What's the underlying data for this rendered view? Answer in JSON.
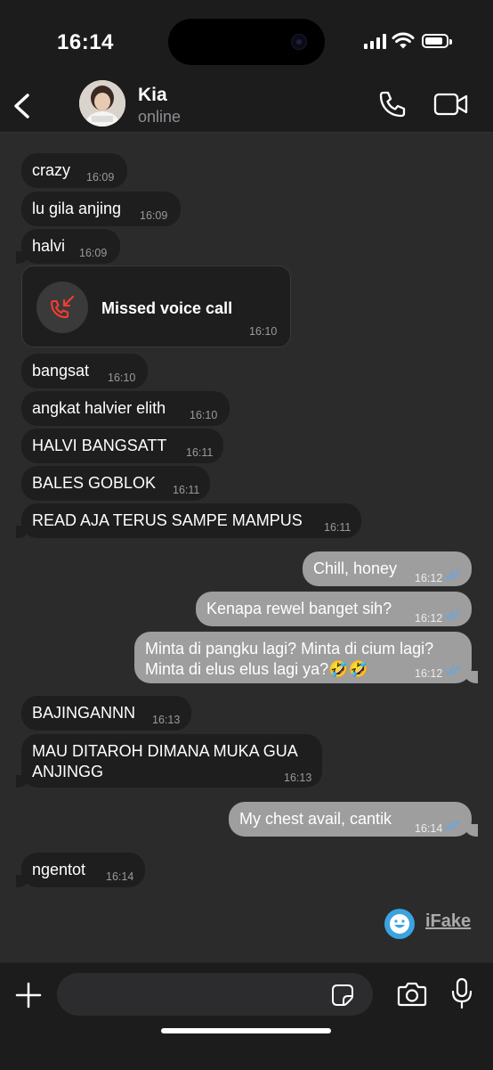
{
  "status_bar": {
    "time": "16:14"
  },
  "header": {
    "contact_name": "Kia",
    "contact_status": "online"
  },
  "messages": [
    {
      "dir": "in",
      "text": "crazy",
      "time": "16:09"
    },
    {
      "dir": "in",
      "text": "lu gila anjing",
      "time": "16:09"
    },
    {
      "dir": "in",
      "text": "halvi",
      "time": "16:09"
    },
    {
      "dir": "in",
      "type": "missed_call",
      "text": "Missed voice call",
      "time": "16:10"
    },
    {
      "dir": "in",
      "text": "bangsat",
      "time": "16:10"
    },
    {
      "dir": "in",
      "text": "angkat halvier elith",
      "time": "16:10"
    },
    {
      "dir": "in",
      "text": "HALVI BANGSATT",
      "time": "16:11"
    },
    {
      "dir": "in",
      "text": "BALES GOBLOK",
      "time": "16:11"
    },
    {
      "dir": "in",
      "text": "READ AJA TERUS SAMPE MAMPUS",
      "time": "16:11"
    },
    {
      "dir": "out",
      "text": "Chill, honey",
      "time": "16:12",
      "read": true
    },
    {
      "dir": "out",
      "text": "Kenapa rewel banget sih?",
      "time": "16:12",
      "read": true
    },
    {
      "dir": "out",
      "lines": [
        "Minta di pangku lagi? Minta di cium lagi?",
        "Minta di elus elus lagi ya?🤣🤣"
      ],
      "time": "16:12",
      "read": true
    },
    {
      "dir": "in",
      "text": "BAJINGANNN",
      "time": "16:13"
    },
    {
      "dir": "in",
      "lines": [
        "MAU DITAROH DIMANA MUKA GUA",
        "ANJINGG"
      ],
      "time": "16:13"
    },
    {
      "dir": "out",
      "text": "My chest avail, cantik",
      "time": "16:14",
      "read": true
    },
    {
      "dir": "in",
      "text": "ngentot",
      "time": "16:14"
    }
  ],
  "watermark": {
    "text": "iFake"
  },
  "input": {
    "value": "",
    "placeholder": ""
  },
  "icons": {
    "back": "chevron-left-icon",
    "call": "phone-icon",
    "video": "video-camera-icon",
    "missed": "missed-call-icon",
    "plus": "plus-icon",
    "sticker": "sticker-icon",
    "camera": "camera-icon",
    "mic": "microphone-icon",
    "read": "double-check-icon"
  },
  "colors": {
    "background": "#2b2b2b",
    "incoming_bubble": "#1e1e1e",
    "outgoing_bubble": "#9e9e9e",
    "read_check": "#5aa9f0",
    "missed_call": "#ff3b30",
    "bar": "#1c1c1c"
  }
}
